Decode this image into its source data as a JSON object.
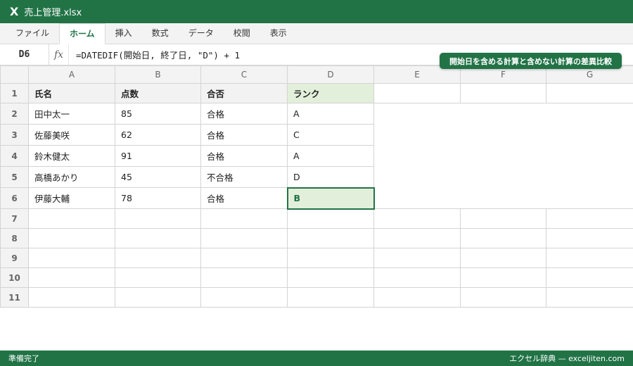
{
  "app": {
    "logo": "X",
    "title": "売上管理.xlsx"
  },
  "ribbon": {
    "tabs": [
      "ファイル",
      "ホーム",
      "挿入",
      "数式",
      "データ",
      "校閲",
      "表示"
    ]
  },
  "formula_bar": {
    "cell_ref": "D6",
    "fx_label": "fx",
    "formula": "=DATEDIF(開始日, 終了日, \"D\") + 1"
  },
  "badge": "開始日を含める計算と含めない計算の差異比較",
  "sheet": {
    "columns": [
      "A",
      "B",
      "C",
      "D",
      "E",
      "F",
      "G"
    ],
    "row_numbers": [
      "1",
      "2",
      "3",
      "4",
      "5",
      "6",
      "7",
      "8",
      "9",
      "10",
      "11"
    ],
    "header": [
      "氏名",
      "点数",
      "合否",
      "ランク"
    ],
    "rows": [
      [
        "田中太一",
        "85",
        "合格",
        "A"
      ],
      [
        "佐藤美咲",
        "62",
        "合格",
        "C"
      ],
      [
        "鈴木健太",
        "91",
        "合格",
        "A"
      ],
      [
        "高橋あかり",
        "45",
        "不合格",
        "D"
      ],
      [
        "伊藤大輔",
        "78",
        "合格",
        "B"
      ]
    ],
    "selected_cell": "D6"
  },
  "status": {
    "left": "準備完了",
    "right": "エクセル辞典 — exceljiten.com"
  },
  "colors": {
    "accent": "#217346",
    "selected_fill": "#e2efda",
    "header_fill": "#f2f2f2"
  }
}
